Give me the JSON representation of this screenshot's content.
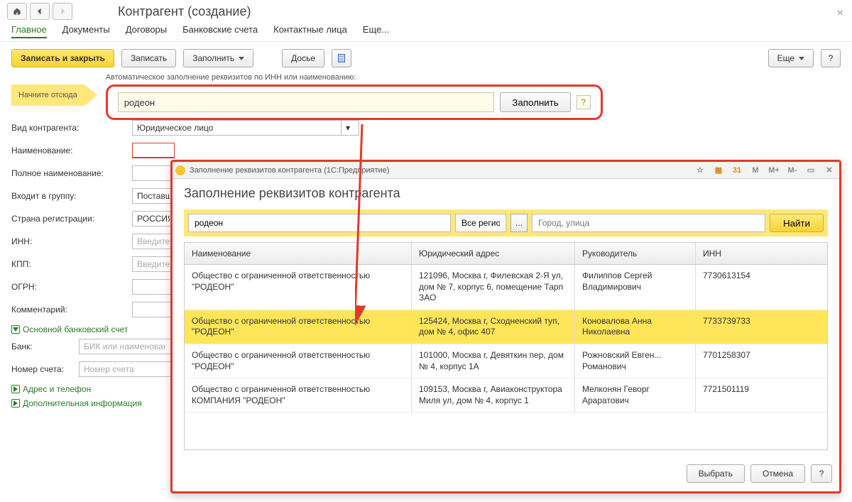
{
  "header": {
    "title": "Контрагент (создание)"
  },
  "nav_tabs": {
    "main": "Главное",
    "docs": "Документы",
    "contracts": "Договоры",
    "bank": "Банковские счета",
    "contacts": "Контактные лица",
    "more": "Еще..."
  },
  "toolbar": {
    "save_close": "Записать и закрыть",
    "save": "Записать",
    "fill": "Заполнить",
    "dossier": "Досье",
    "more": "Еще",
    "help": "?"
  },
  "start_hint": {
    "arrow_label": "Начните отсюда",
    "title": "Автоматическое заполнение реквизитов по ИНН или наименованию:",
    "input_value": "родеон",
    "fill_btn": "Заполнить",
    "help": "?"
  },
  "form": {
    "type_label": "Вид контрагента:",
    "type_value": "Юридическое лицо",
    "name_label": "Наименование:",
    "full_name_label": "Полное наименование:",
    "group_label": "Входит в группу:",
    "group_value": "Поставщ",
    "country_label": "Страна регистрации:",
    "country_value": "РОССИЯ",
    "inn_label": "ИНН:",
    "inn_placeholder": "Введите",
    "kpp_label": "КПП:",
    "kpp_placeholder": "Введите",
    "ogrn_label": "ОГРН:",
    "comment_label": "Комментарий:",
    "section_bank": "Основной банковский счет",
    "bank_label": "Банк:",
    "bank_placeholder": "БИК или наименован",
    "acct_label": "Номер счета:",
    "acct_placeholder": "Номер счета",
    "section_addr": "Адрес и телефон",
    "section_extra": "Дополнительная информация"
  },
  "modal": {
    "window_title": "Заполнение реквизитов контрагента  (1С:Предприятие)",
    "heading": "Заполнение реквизитов контрагента",
    "tbtn_m": "M",
    "tbtn_mplus": "M+",
    "tbtn_mminus": "M-",
    "search": {
      "query": "родеон",
      "region_value": "Все регио",
      "city_placeholder": "Город, улица",
      "find": "Найти"
    },
    "columns": {
      "name": "Наименование",
      "addr": "Юридический адрес",
      "head": "Руководитель",
      "inn": "ИНН"
    },
    "rows": [
      {
        "name": "Общество с ограниченной ответственностью \"РОДЕОН\"",
        "addr": "121096, Москва г, Филевская 2-Я ул, дом № 7, корпус 6, помещение Тарп ЗАО",
        "head": "Филиппов Сергей Владимирович",
        "inn": "7730613154"
      },
      {
        "name": "Общество с ограниченной ответственностью \"РОДЕОН\"",
        "addr": "125424, Москва г, Сходненский туп, дом № 4, офис 407",
        "head": "Коновалова Анна Николаевна",
        "inn": "7733739733"
      },
      {
        "name": "Общество с ограниченной ответственностью \"РОДЕОН\"",
        "addr": "101000, Москва г, Девяткин пер, дом № 4, корпус 1А",
        "head": "Рожновский Евген... Романович",
        "inn": "7701258307"
      },
      {
        "name": "Общество с ограниченной ответственностью КОМПАНИЯ \"РОДЕОН\"",
        "addr": "109153, Москва г, Авиаконструктора Миля ул, дом № 4, корпус 1",
        "head": "Мелконян Геворг Араратович",
        "inn": "7721501119"
      }
    ],
    "footer": {
      "choose": "Выбрать",
      "cancel": "Отмена",
      "help": "?"
    }
  }
}
